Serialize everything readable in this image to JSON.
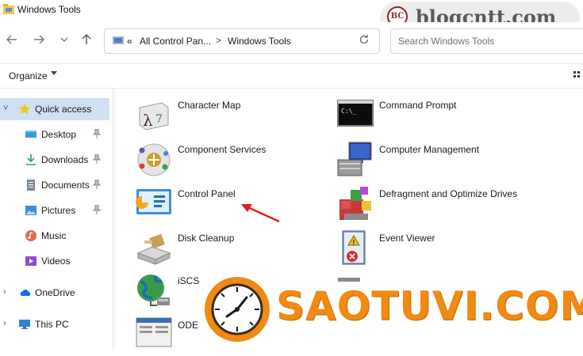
{
  "window": {
    "title": "Windows Tools"
  },
  "watermark": {
    "badge": "BC",
    "text": "blogcntt.com"
  },
  "nav": {
    "back_icon": "arrow-left-icon",
    "forward_icon": "arrow-right-icon",
    "recent_icon": "chevron-down-icon",
    "up_icon": "arrow-up-icon"
  },
  "address": {
    "overflow": "«",
    "crumbs": [
      "All Control Pan...",
      "Windows Tools"
    ],
    "separator": ">"
  },
  "search": {
    "placeholder": "Search Windows Tools"
  },
  "toolbar": {
    "organize_label": "Organize"
  },
  "sidebar": {
    "items": [
      {
        "label": "Quick access",
        "icon": "star-icon",
        "selected": true
      },
      {
        "label": "Desktop",
        "icon": "desktop-icon",
        "pinned": true
      },
      {
        "label": "Downloads",
        "icon": "download-icon",
        "pinned": true
      },
      {
        "label": "Documents",
        "icon": "document-icon",
        "pinned": true
      },
      {
        "label": "Pictures",
        "icon": "pictures-icon",
        "pinned": true
      },
      {
        "label": "Music",
        "icon": "music-icon"
      },
      {
        "label": "Videos",
        "icon": "video-icon"
      },
      {
        "label": "OneDrive",
        "icon": "cloud-icon"
      },
      {
        "label": "This PC",
        "icon": "computer-icon"
      }
    ]
  },
  "tools": {
    "left": [
      "Character Map",
      "Component Services",
      "Control Panel",
      "Disk Cleanup",
      "iSCS",
      "ODE"
    ],
    "right": [
      "Command Prompt",
      "Computer Management",
      "Defragment and Optimize Drives",
      "Event Viewer"
    ]
  },
  "overlay": {
    "brand_text": "SAOTUVI.COM"
  },
  "colors": {
    "selected": "#cfe0f2",
    "accent": "#0067c0",
    "brand": "#f08a12",
    "arrow": "#e02020"
  }
}
